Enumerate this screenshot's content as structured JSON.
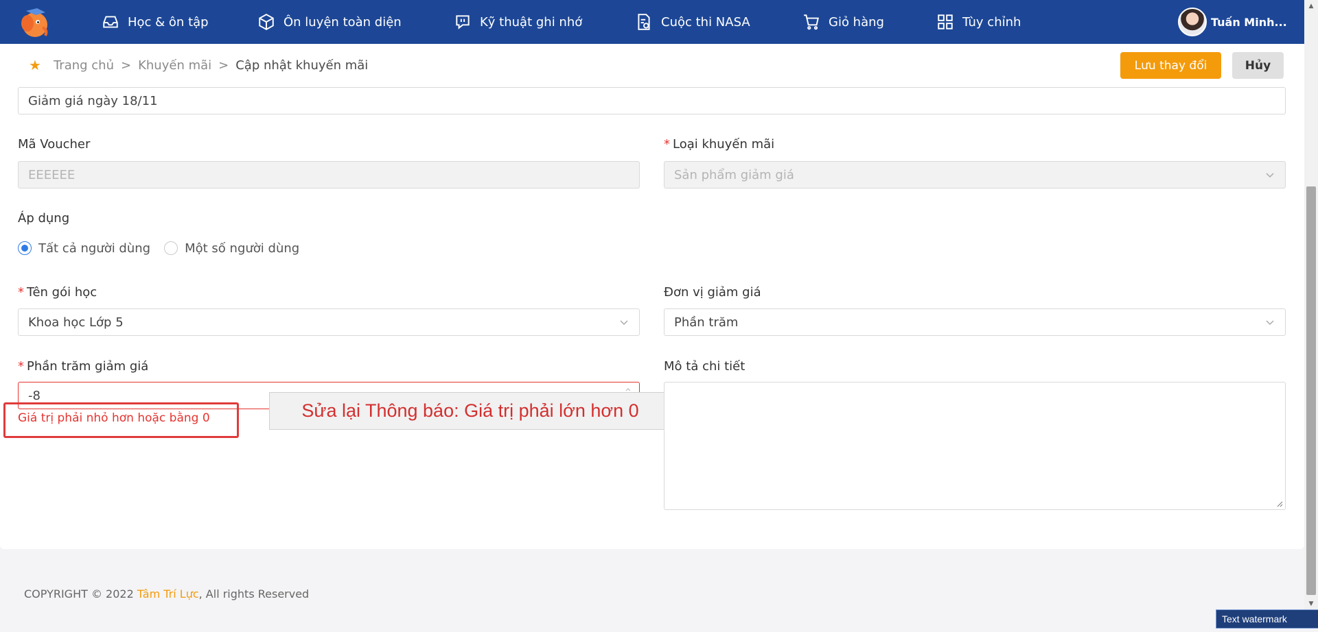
{
  "nav": {
    "items": [
      {
        "label": "Học & ôn tập",
        "icon": "inbox-icon"
      },
      {
        "label": "Ôn luyện toàn diện",
        "icon": "cube-icon"
      },
      {
        "label": "Kỹ thuật ghi nhớ",
        "icon": "chat-icon"
      },
      {
        "label": "Cuộc thi NASA",
        "icon": "document-check-icon"
      },
      {
        "label": "Giỏ hàng",
        "icon": "cart-icon"
      },
      {
        "label": "Tùy chỉnh",
        "icon": "grid-icon"
      }
    ],
    "user_name": "Tuấn Minh..."
  },
  "breadcrumb": {
    "home": "Trang chủ",
    "section": "Khuyến mãi",
    "current": "Cập nhật khuyến mãi",
    "separator": ">"
  },
  "actions": {
    "save_label": "Lưu thay đổi",
    "cancel_label": "Hủy"
  },
  "form": {
    "promo_name_value": "Giảm giá ngày 18/11",
    "voucher_label": "Mã Voucher",
    "voucher_value": "EEEEEE",
    "promo_type_label": "Loại khuyến mãi",
    "promo_type_value": "Sản phẩm giảm giá",
    "apply_label": "Áp dụng",
    "apply_options": [
      "Tất cả người dùng",
      "Một số người dùng"
    ],
    "apply_selected": "Tất cả người dùng",
    "course_label": "Tên gói học",
    "course_value": "Khoa học Lớp 5",
    "discount_unit_label": "Đơn vị giảm giá",
    "discount_unit_value": "Phần trăm",
    "discount_percent_label": "Phần trăm giảm giá",
    "discount_percent_value": "-8",
    "discount_error": "Giá trị phải nhỏ hơn hoặc bằng 0",
    "description_label": "Mô tả chi tiết",
    "required_mark": "*"
  },
  "annotation": {
    "text": "Sửa lại Thông báo: Giá trị phải lớn hơn 0"
  },
  "footer": {
    "prefix": "COPYRIGHT © 2022 ",
    "brand": "Tâm Trí Lực",
    "suffix": ", All rights Reserved"
  },
  "watermark": {
    "text": "Text watermark"
  },
  "colors": {
    "navbar": "#1d4796",
    "accent": "#f49b0b",
    "error": "#e5342f",
    "radio": "#2f7be5"
  }
}
